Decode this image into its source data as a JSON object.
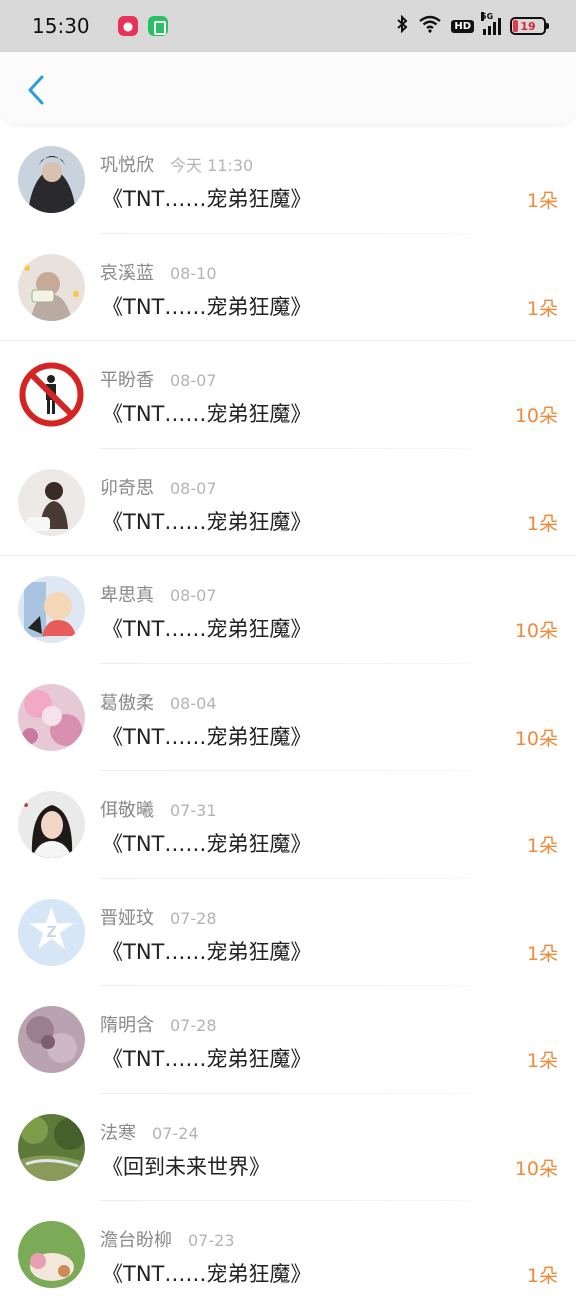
{
  "status_bar": {
    "time": "15:30",
    "network_label": "5G",
    "hd_label": "HD",
    "battery_level": "19"
  },
  "colors": {
    "status_bar_bg": "#d9d9d9",
    "back_arrow": "#2b9be6",
    "count_orange": "#f08a3a",
    "name_gray": "#8a8a8a"
  },
  "items": [
    {
      "name": "巩悦欣",
      "date": "今天 11:30",
      "book": "《TNT……宠弟狂魔》",
      "count": "1朵"
    },
    {
      "name": "哀溪蓝",
      "date": "08-10",
      "book": "《TNT……宠弟狂魔》",
      "count": "1朵"
    },
    {
      "name": "平盼香",
      "date": "08-07",
      "book": "《TNT……宠弟狂魔》",
      "count": "10朵"
    },
    {
      "name": "卯奇思",
      "date": "08-07",
      "book": "《TNT……宠弟狂魔》",
      "count": "1朵"
    },
    {
      "name": "卑思真",
      "date": "08-07",
      "book": "《TNT……宠弟狂魔》",
      "count": "10朵"
    },
    {
      "name": "葛傲柔",
      "date": "08-04",
      "book": "《TNT……宠弟狂魔》",
      "count": "10朵"
    },
    {
      "name": "佴敬曦",
      "date": "07-31",
      "book": "《TNT……宠弟狂魔》",
      "count": "1朵"
    },
    {
      "name": "晋娅玟",
      "date": "07-28",
      "book": "《TNT……宠弟狂魔》",
      "count": "1朵"
    },
    {
      "name": "隋明含",
      "date": "07-28",
      "book": "《TNT……宠弟狂魔》",
      "count": "1朵"
    },
    {
      "name": "法寒",
      "date": "07-24",
      "book": "《回到未来世界》",
      "count": "10朵"
    },
    {
      "name": "澹台盼柳",
      "date": "07-23",
      "book": "《TNT……宠弟狂魔》",
      "count": "1朵"
    }
  ]
}
